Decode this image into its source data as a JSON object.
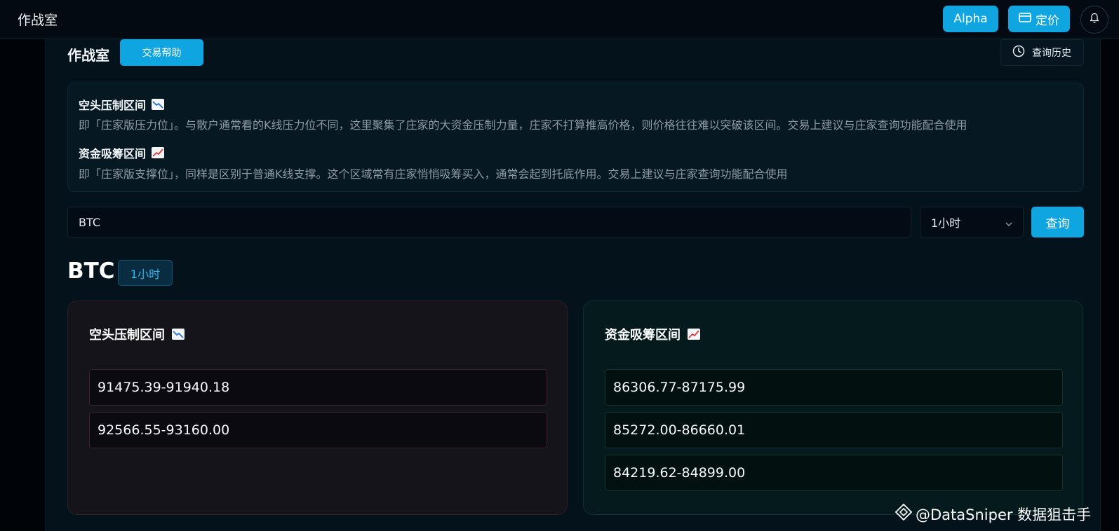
{
  "topbar": {
    "app_title": "作战室",
    "alpha_label": "Alpha",
    "pricing_label": "定价"
  },
  "page": {
    "heading": "作战室",
    "help_label": "交易帮助",
    "history_label": "查询历史"
  },
  "info": {
    "resistance_title": "空头压制区间",
    "resistance_desc": "即「庄家版压力位」。与散户通常看的K线压力位不同，这里聚集了庄家的大资金压制力量，庄家不打算推高价格，则价格往往难以突破该区间。交易上建议与庄家查询功能配合使用",
    "support_title": "资金吸筹区间",
    "support_desc": "即「庄家版支撑位」，同样是区别于普通K线支撑。这个区域常有庄家悄悄吸筹买入，通常会起到托底作用。交易上建议与庄家查询功能配合使用"
  },
  "search": {
    "value": "BTC",
    "interval": "1小时",
    "query_label": "查询"
  },
  "result": {
    "symbol": "BTC",
    "interval": "1小时",
    "bear_card": {
      "title": "空头压制区间",
      "ranges": [
        "91475.39-91940.18",
        "92566.55-93160.00"
      ]
    },
    "bull_card": {
      "title": "资金吸筹区间",
      "ranges": [
        "86306.77-87175.99",
        "85272.00-86660.01",
        "84219.62-84899.00"
      ]
    }
  },
  "watermark": {
    "text": "@DataSniper 数据狙击手"
  },
  "colors": {
    "accent": "#0ea5e0",
    "background": "#04121c",
    "bear_card_bg": "#15141b",
    "bull_card_bg": "#041a1c"
  },
  "icons": {
    "pricing": "card-icon",
    "bell": "bell-icon",
    "history": "clock-icon",
    "resistance": "chart-decreasing-icon",
    "support": "chart-increasing-icon",
    "select": "chevron-down-icon",
    "watermark": "diamond-logo-icon"
  }
}
